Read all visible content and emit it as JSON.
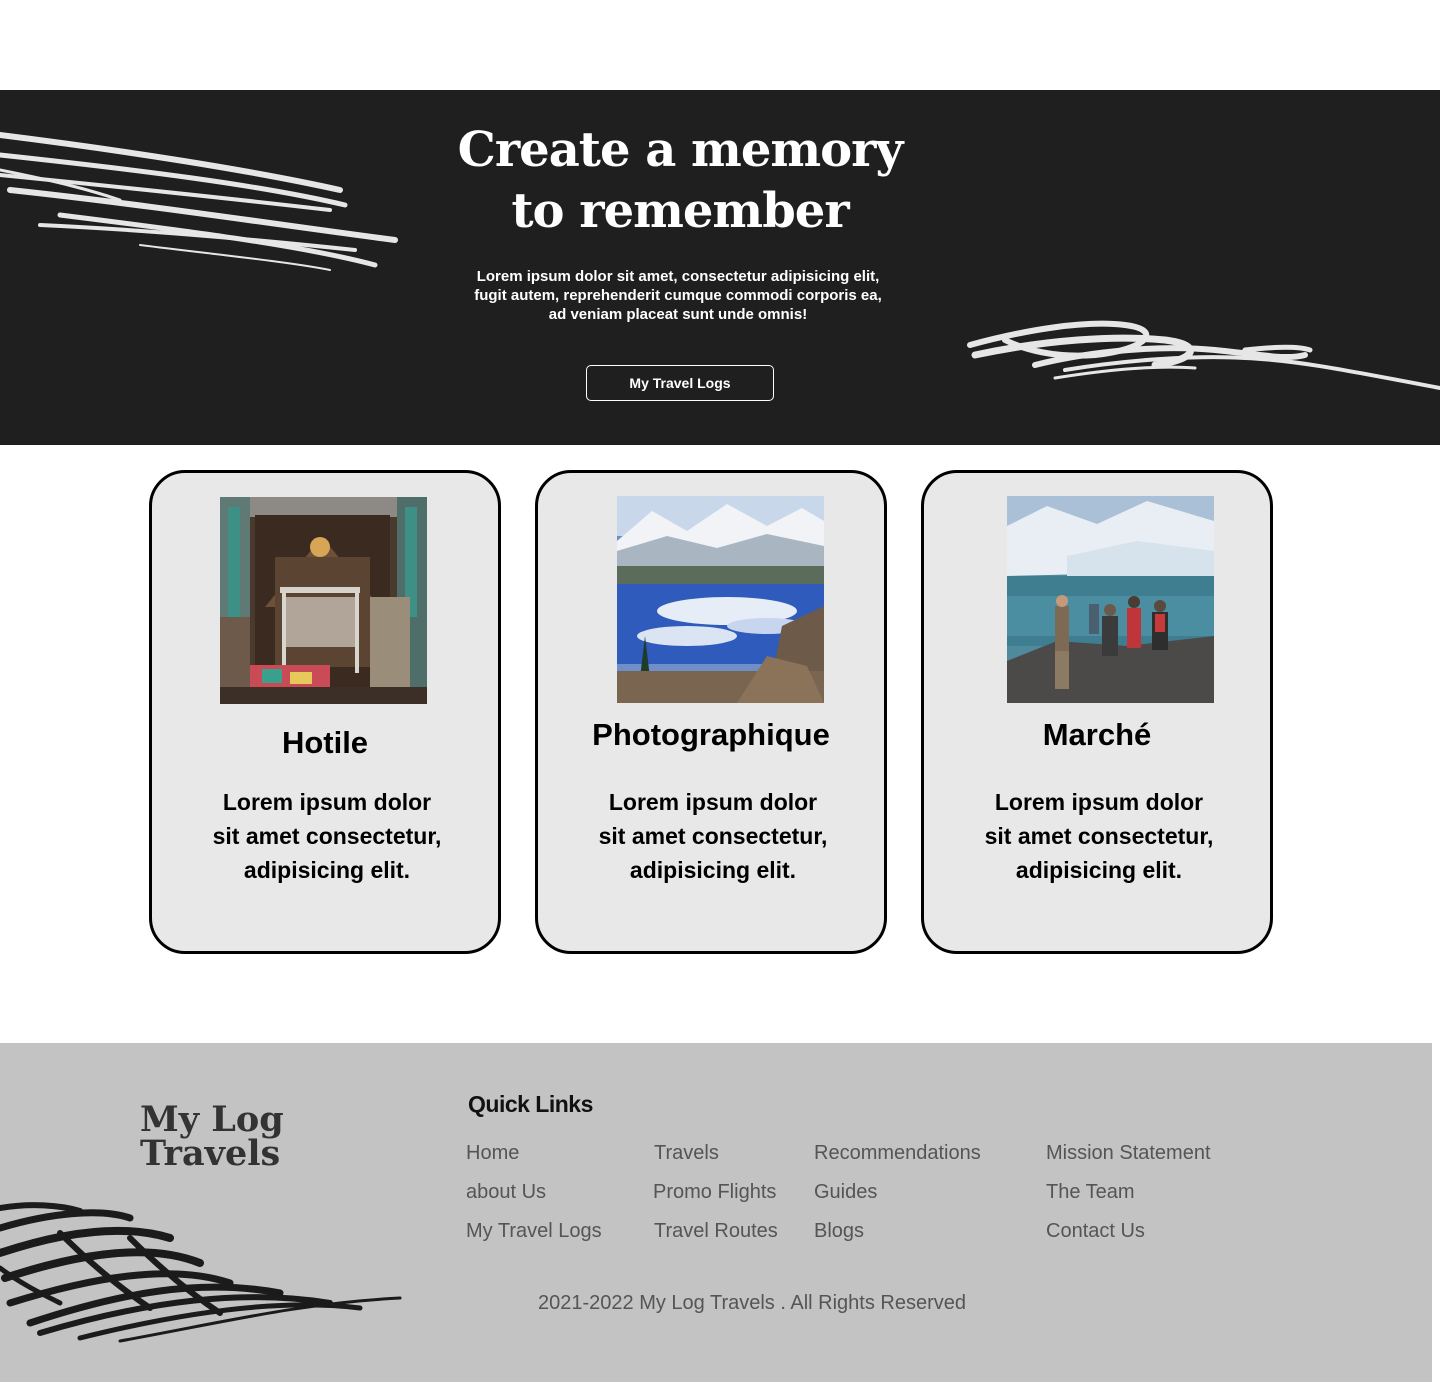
{
  "hero": {
    "title": "Create a memory\nto remember",
    "text": "Lorem ipsum dolor sit amet, consectetur adipisicing elit,\nfugit autem, reprehenderit cumque commodi corporis ea,\nad veniam placeat sunt unde omnis!",
    "button_label": "My Travel Logs",
    "background_color": "#1f1f1f"
  },
  "cards": [
    {
      "title": "Hotile",
      "text": "Lorem ipsum dolor sit amet consectetur, adipisicing elit.",
      "image": "hotel-room-photo"
    },
    {
      "title": "Photographique",
      "text": "Lorem ipsum dolor sit amet consectetur, adipisicing elit.",
      "image": "mountain-lake-photo"
    },
    {
      "title": "Marché",
      "text": "Lorem ipsum dolor sit amet consectetur, adipisicing elit.",
      "image": "glacier-hikers-photo"
    }
  ],
  "footer": {
    "logo": "My Log\nTravels",
    "quick_links_title": "Quick Links",
    "links": {
      "home": "Home",
      "about": "about Us",
      "travel_logs": "My Travel Logs",
      "travels": "Travels",
      "promo_flights": "Promo Flights",
      "travel_routes": "Travel Routes",
      "recommendations": "Recommendations",
      "guides": "Guides",
      "blogs": "Blogs",
      "mission": "Mission Statement",
      "team": "The Team",
      "contact": "Contact Us"
    },
    "copyright": "2021-2022 My Log Travels . All Rights Reserved",
    "background_color": "#c3c3c3"
  }
}
